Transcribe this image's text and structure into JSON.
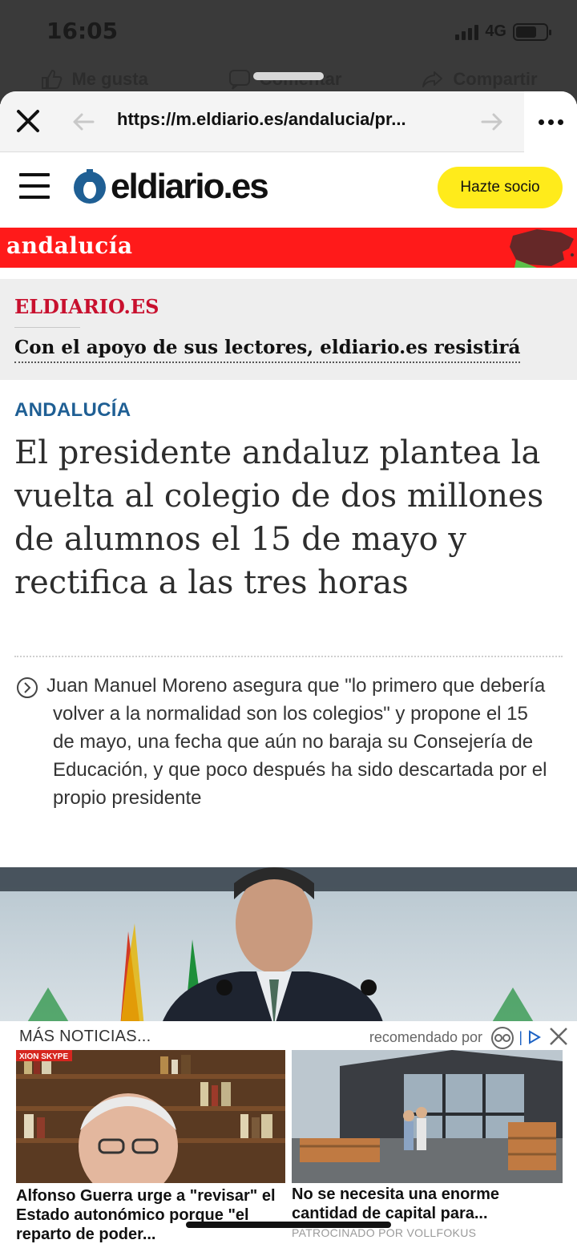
{
  "status": {
    "time": "16:05",
    "network": "4G",
    "battery_level": 0.7,
    "signal_bars": 4
  },
  "background_actions": [
    {
      "label": "Me gusta",
      "icon": "thumbs-up-icon"
    },
    {
      "label": "Comentar",
      "icon": "comment-icon"
    },
    {
      "label": "Compartir",
      "icon": "share-icon"
    }
  ],
  "browser": {
    "url": "https://m.eldiario.es/andalucia/pr..."
  },
  "site": {
    "logo": "eldiario.es",
    "cta_label": "Hazte socio",
    "brand_color": "#1f5f94",
    "cta_color": "#ffeb1b"
  },
  "section": {
    "label": "andalucía",
    "color": "#ff1a1a"
  },
  "promo": {
    "kicker": "ELDIARIO.ES",
    "text": "Con el apoyo de sus lectores, eldiario.es resistirá"
  },
  "article": {
    "category": "ANDALUCÍA",
    "headline": "El presidente andaluz plantea la vuelta al colegio de dos millones de alumnos el 15 de mayo y rectifica a las tres horas",
    "summary": "Juan Manuel Moreno asegura que \"lo primero que debería volver a la normalidad son los colegios\" y propone el 15 de mayo, una fecha que aún no baraja su Consejería de Educación, y que poco después ha sido descartada por el propio presidente"
  },
  "recommendations": {
    "heading": "MÁS NOTICIAS...",
    "by_label": "recomendado por",
    "items": [
      {
        "title": "Alfonso Guerra urge a \"revisar\" el Estado autonómico porque \"el reparto de poder...",
        "badge": "XION SKYPE",
        "sponsor": ""
      },
      {
        "title": "No se necesita una enorme cantidad de capital para...",
        "sponsor": "PATROCINADO POR VOLLFOKUS"
      }
    ]
  }
}
